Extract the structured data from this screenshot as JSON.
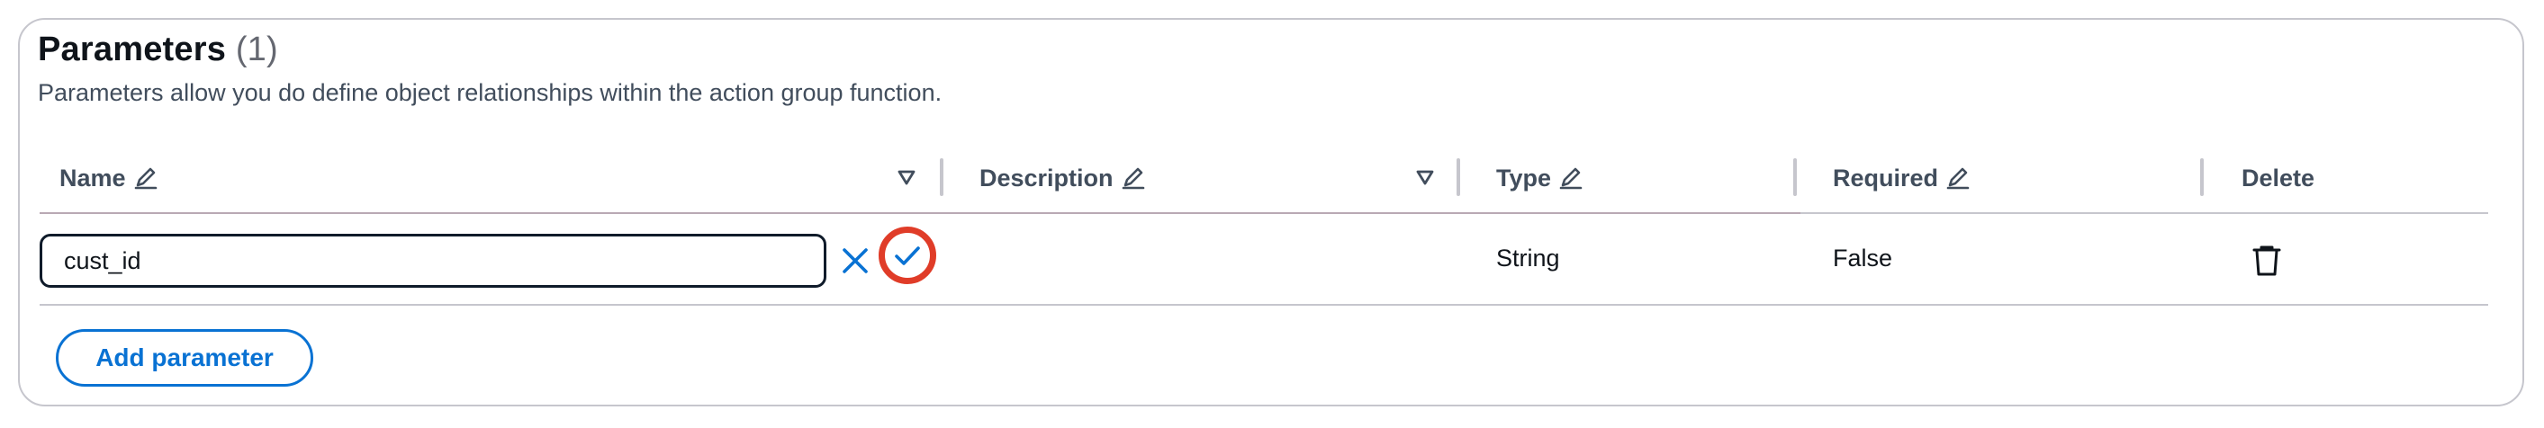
{
  "section": {
    "title": "Parameters",
    "count": "(1)",
    "description": "Parameters allow you do define object relationships within the action group function."
  },
  "columns": {
    "name": "Name",
    "description": "Description",
    "type": "Type",
    "required": "Required",
    "delete": "Delete"
  },
  "rows": [
    {
      "name_value": "cust_id",
      "description": "",
      "type": "String",
      "required": "False"
    }
  ],
  "actions": {
    "add_parameter": "Add parameter"
  },
  "icons": {
    "edit": "pencil-icon",
    "sort": "sort-down-icon",
    "cancel": "close-icon",
    "confirm": "checkmark-icon",
    "delete": "trash-icon"
  },
  "colors": {
    "accent": "#0972d3",
    "highlight_ring": "#e03c28",
    "border": "#c6c6cd",
    "heading_text": "#414d5c"
  }
}
